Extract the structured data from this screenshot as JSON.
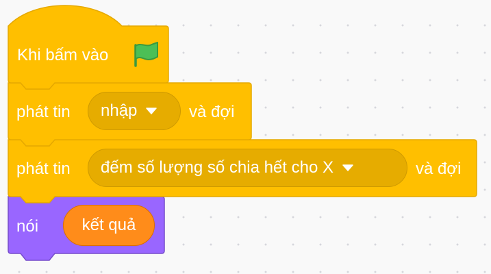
{
  "colors": {
    "event_block": "#ffbf00",
    "event_border": "#e6a900",
    "event_input": "#e6ac00",
    "looks_block": "#9966ff",
    "looks_border": "#774dcb",
    "reporter": "#ff8c1a",
    "flag": "#4cbf56",
    "canvas_background": "#f9f9f9"
  },
  "script": {
    "hat_block": {
      "label": "Khi bấm vào",
      "icon": "green-flag-icon"
    },
    "broadcast_1": {
      "label": "phát tin",
      "dropdown_value": "nhập",
      "suffix": "và đợi"
    },
    "broadcast_2": {
      "label": "phát tin",
      "dropdown_value": "đếm số lượng số chia hết cho X",
      "suffix": "và đợi"
    },
    "say_block": {
      "label": "nói",
      "reporter_value": "kết quả"
    }
  }
}
